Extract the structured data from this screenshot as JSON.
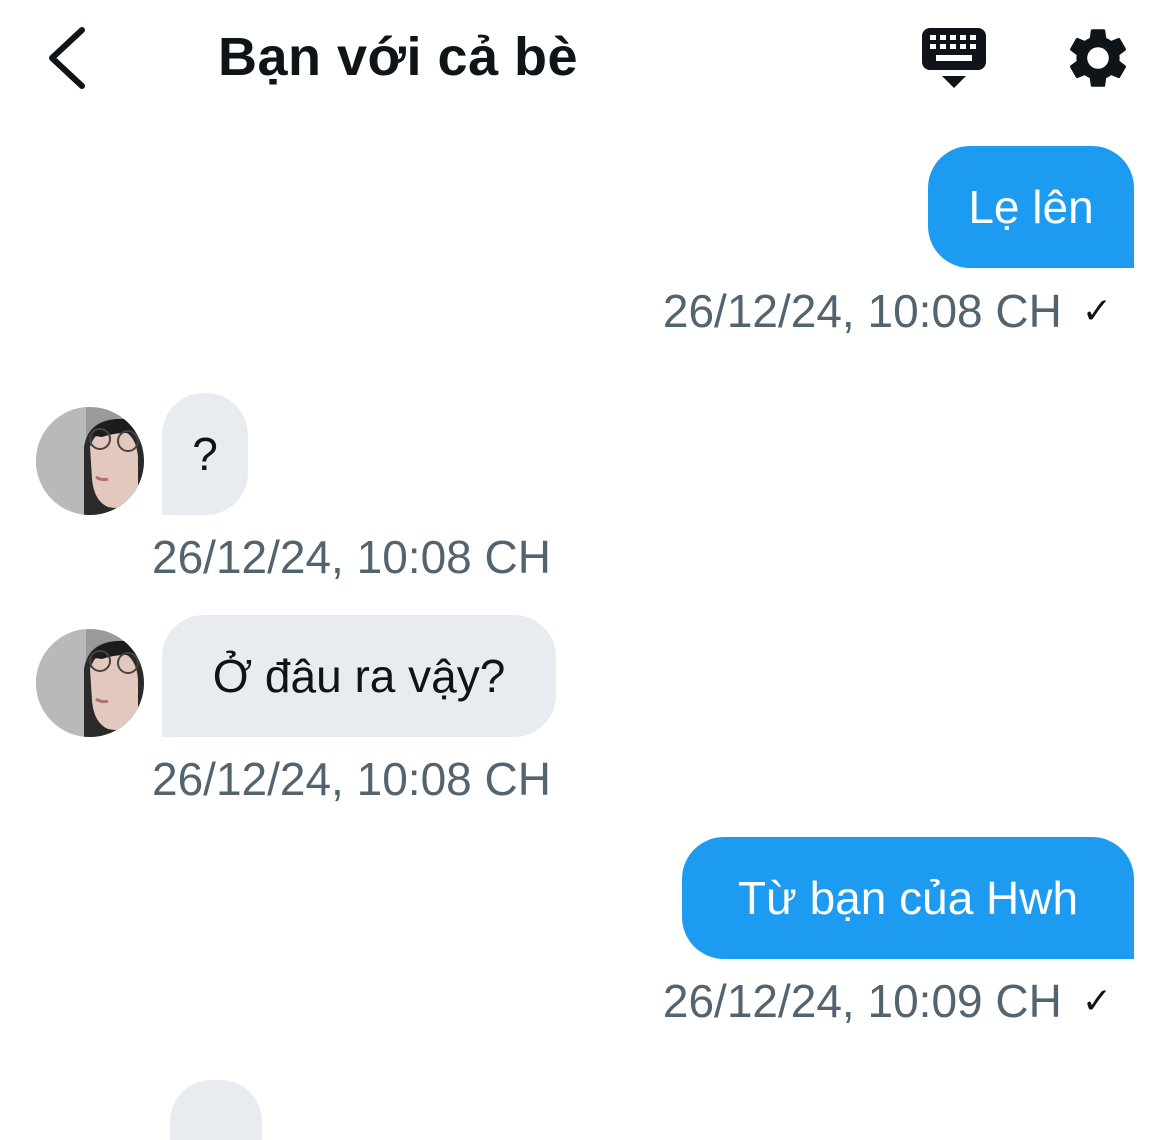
{
  "header": {
    "title": "Bạn với cả bè",
    "back_icon": "chevron-left-icon",
    "keyboard_icon": "keyboard-icon",
    "settings_icon": "gear-icon"
  },
  "colors": {
    "accent": "#1d9bf0",
    "incoming_bubble": "#e8ecf0",
    "timestamp": "#536471",
    "text": "#0f1419"
  },
  "messages": [
    {
      "direction": "outgoing",
      "text": "Lẹ lên",
      "timestamp": "26/12/24, 10:08 CH",
      "status": "✓"
    },
    {
      "direction": "incoming",
      "text": "?",
      "timestamp": "26/12/24, 10:08 CH"
    },
    {
      "direction": "incoming",
      "text": "Ở đâu ra vậy?",
      "timestamp": "26/12/24, 10:08 CH"
    },
    {
      "direction": "outgoing",
      "text": "Từ bạn của Hwh",
      "timestamp": "26/12/24, 10:09 CH",
      "status": "✓"
    }
  ]
}
